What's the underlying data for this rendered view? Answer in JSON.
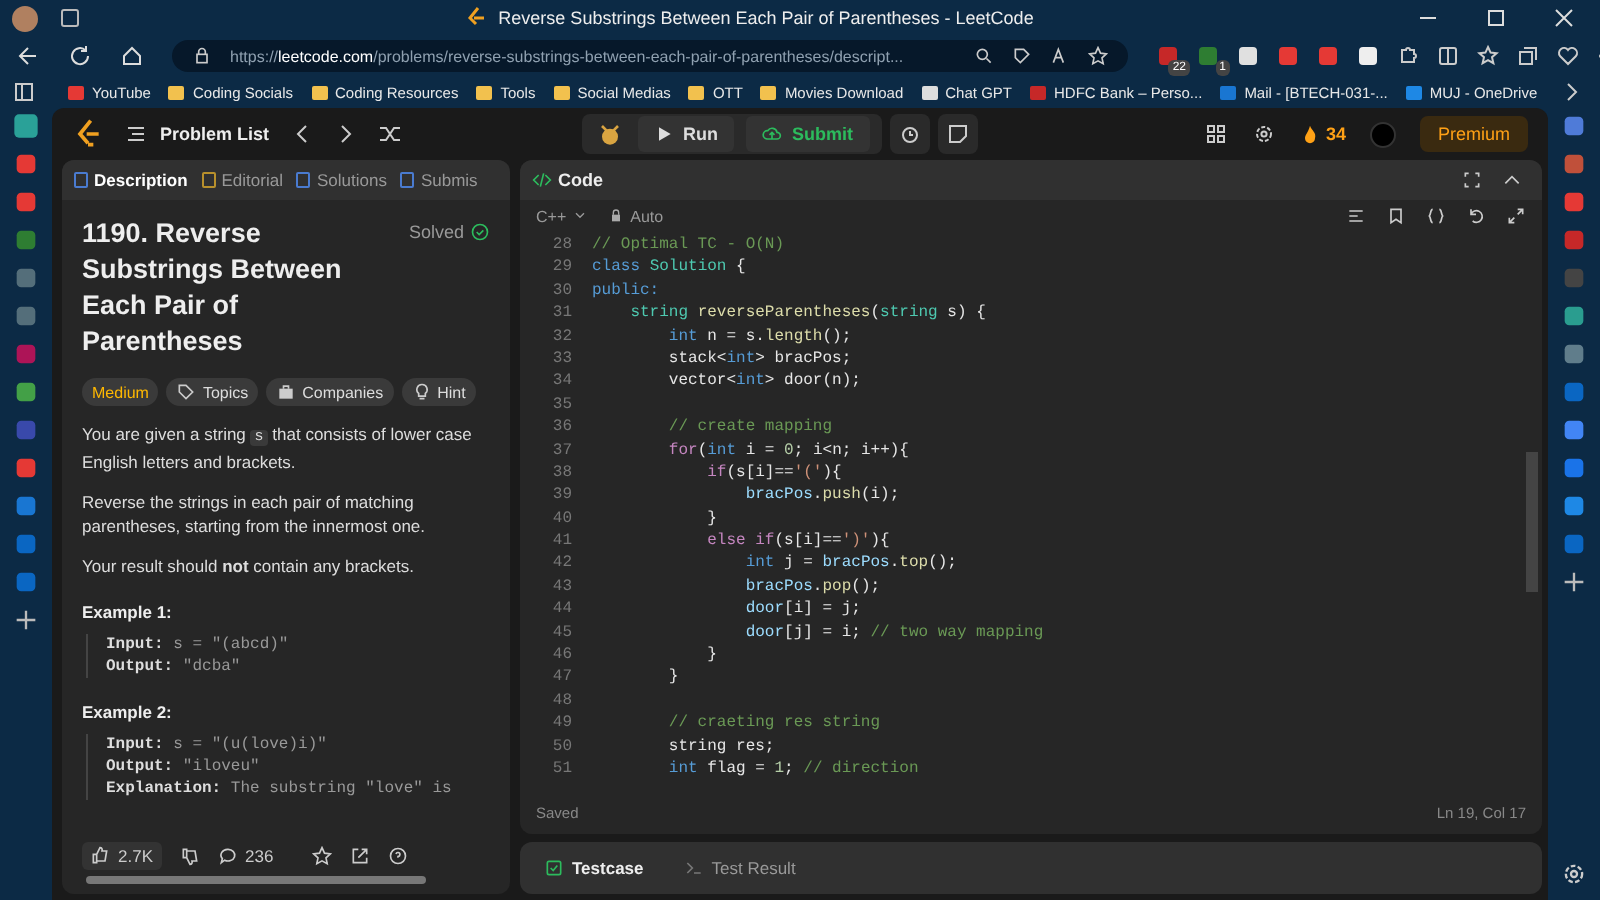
{
  "browser": {
    "title": "Reverse Substrings Between Each Pair of Parentheses - LeetCode",
    "url": "https://**leetcode.com**/problems/reverse-substrings-between-each-pair-of-parentheses/descript...",
    "extensions": [
      {
        "badge": "22"
      },
      {
        "badge": "1"
      }
    ],
    "bookmarks": [
      "YouTube",
      "Coding Socials",
      "Coding Resources",
      "Tools",
      "Social Medias",
      "OTT",
      "Movies Download",
      "Chat GPT",
      "HDFC Bank – Perso...",
      "Mail - [BTECH-031-...",
      "MUJ - OneDrive"
    ]
  },
  "header": {
    "problem_list": "Problem List",
    "run": "Run",
    "submit": "Submit",
    "streak": "34",
    "premium": "Premium"
  },
  "description": {
    "tabs": [
      {
        "label": "Description",
        "selected": true
      },
      {
        "label": "Editorial",
        "selected": false
      },
      {
        "label": "Solutions",
        "selected": false
      },
      {
        "label": "Submis",
        "selected": false
      }
    ],
    "title": "1190. Reverse Substrings Between Each Pair of Parentheses",
    "status": "Solved",
    "tags": [
      {
        "label": "Medium",
        "kind": "difficulty"
      },
      {
        "label": "Topics",
        "kind": "topics"
      },
      {
        "label": "Companies",
        "kind": "companies"
      },
      {
        "label": "Hint",
        "kind": "hint"
      }
    ],
    "paragraphs": [
      [
        {
          "text": "You are given a string "
        },
        {
          "text": "s",
          "kind": "code"
        },
        {
          "text": " that consists of lower case English letters and brackets."
        }
      ],
      [
        {
          "text": "Reverse the strings in each pair of matching parentheses, starting from the innermost one."
        }
      ],
      [
        {
          "text": "Your result should **not** contain any brackets."
        }
      ]
    ],
    "examples": [
      {
        "heading": "Example 1:",
        "lines": [
          {
            "label": "Input:",
            "value": "s = \"(abcd)\""
          },
          {
            "label": "Output:",
            "value": "\"dcba\""
          }
        ]
      },
      {
        "heading": "Example 2:",
        "lines": [
          {
            "label": "Input:",
            "value": "s = \"(u(love)i)\""
          },
          {
            "label": "Output:",
            "value": "\"iloveu\""
          },
          {
            "label": "Explanation:",
            "value": "The substring \"love\" is"
          }
        ]
      }
    ],
    "likes": "2.7K",
    "comments": "236"
  },
  "editor": {
    "title": "Code",
    "language": "C++",
    "mode": "Auto",
    "status": "Saved",
    "cursor": "Ln 19, Col 17",
    "lines": [
      {
        "number": "28",
        "segments": [
          {
            "text": "// Optimal TC - O(N)",
            "kind": "comment"
          }
        ]
      },
      {
        "number": "29",
        "segments": [
          {
            "text": "class ",
            "kind": "keyword"
          },
          {
            "text": "Solution",
            "kind": "type"
          },
          {
            "text": " {"
          }
        ]
      },
      {
        "number": "30",
        "segments": [
          {
            "text": "public:",
            "kind": "keyword"
          }
        ]
      },
      {
        "number": "31",
        "segments": [
          {
            "text": "    string ",
            "kind": "type"
          },
          {
            "text": "reverseParentheses",
            "kind": "function"
          },
          {
            "text": "("
          },
          {
            "text": "string",
            "kind": "type"
          },
          {
            "text": " s) {"
          }
        ]
      },
      {
        "number": "32",
        "segments": [
          {
            "text": "        int",
            "kind": "keyword"
          },
          {
            "text": " n = s."
          },
          {
            "text": "length",
            "kind": "function"
          },
          {
            "text": "();"
          }
        ]
      },
      {
        "number": "33",
        "segments": [
          {
            "text": "        stack<"
          },
          {
            "text": "int",
            "kind": "keyword"
          },
          {
            "text": "> bracPos;"
          }
        ]
      },
      {
        "number": "34",
        "segments": [
          {
            "text": "        vector<"
          },
          {
            "text": "int",
            "kind": "keyword"
          },
          {
            "text": "> door(n);"
          }
        ]
      },
      {
        "number": "35"
      },
      {
        "number": "36",
        "segments": [
          {
            "text": "        // create mapping",
            "kind": "comment"
          }
        ]
      },
      {
        "number": "37",
        "segments": [
          {
            "text": "        for",
            "kind": "control"
          },
          {
            "text": "("
          },
          {
            "text": "int",
            "kind": "keyword"
          },
          {
            "text": " i = "
          },
          {
            "text": "0",
            "kind": "number"
          },
          {
            "text": "; i<n; i++){"
          }
        ]
      },
      {
        "number": "38",
        "segments": [
          {
            "text": "            if",
            "kind": "control"
          },
          {
            "text": "(s[i]=="
          },
          {
            "text": "'('",
            "kind": "string"
          },
          {
            "text": "){"
          }
        ]
      },
      {
        "number": "39",
        "segments": [
          {
            "text": "                bracPos",
            "kind": "variable"
          },
          {
            "text": "."
          },
          {
            "text": "push",
            "kind": "function"
          },
          {
            "text": "(i);"
          }
        ]
      },
      {
        "number": "40",
        "segments": [
          {
            "text": "            }"
          }
        ]
      },
      {
        "number": "41",
        "segments": [
          {
            "text": "            else if",
            "kind": "control"
          },
          {
            "text": "(s[i]=="
          },
          {
            "text": "')'",
            "kind": "string"
          },
          {
            "text": "){"
          }
        ]
      },
      {
        "number": "42",
        "segments": [
          {
            "text": "                int",
            "kind": "keyword"
          },
          {
            "text": " j = "
          },
          {
            "text": "bracPos",
            "kind": "variable"
          },
          {
            "text": "."
          },
          {
            "text": "top",
            "kind": "function"
          },
          {
            "text": "();"
          }
        ]
      },
      {
        "number": "43",
        "segments": [
          {
            "text": "                bracPos",
            "kind": "variable"
          },
          {
            "text": "."
          },
          {
            "text": "pop",
            "kind": "function"
          },
          {
            "text": "();"
          }
        ]
      },
      {
        "number": "44",
        "segments": [
          {
            "text": "                door",
            "kind": "variable"
          },
          {
            "text": "[i] = j;"
          }
        ]
      },
      {
        "number": "45",
        "segments": [
          {
            "text": "                door",
            "kind": "variable"
          },
          {
            "text": "[j] = i; "
          },
          {
            "text": "// two way mapping",
            "kind": "comment"
          }
        ]
      },
      {
        "number": "46",
        "segments": [
          {
            "text": "            }"
          }
        ]
      },
      {
        "number": "47",
        "segments": [
          {
            "text": "        }"
          }
        ]
      },
      {
        "number": "48"
      },
      {
        "number": "49",
        "segments": [
          {
            "text": "        // craeting res string",
            "kind": "comment"
          }
        ]
      },
      {
        "number": "50",
        "segments": [
          {
            "text": "        string res;"
          }
        ]
      },
      {
        "number": "51",
        "segments": [
          {
            "text": "        int",
            "kind": "keyword"
          },
          {
            "text": " flag = "
          },
          {
            "text": "1",
            "kind": "number"
          },
          {
            "text": "; "
          },
          {
            "text": "// direction",
            "kind": "comment"
          }
        ]
      }
    ]
  },
  "console": {
    "tabs": [
      {
        "label": "Testcase",
        "selected": true
      },
      {
        "label": "Test Result",
        "selected": false
      }
    ]
  }
}
